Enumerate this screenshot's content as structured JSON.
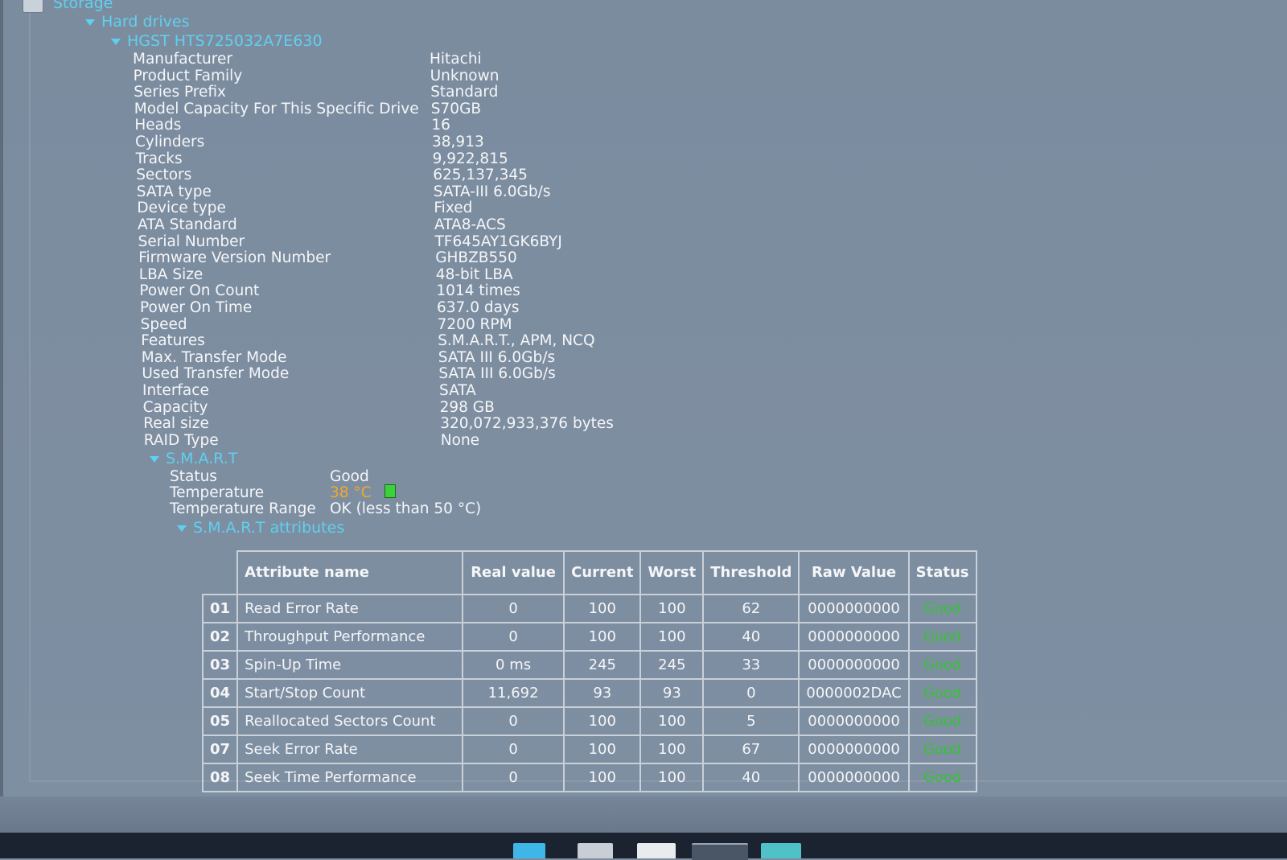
{
  "tree": {
    "storage_label": "Storage",
    "hard_drives_label": "Hard drives",
    "drive_label": "HGST HTS725032A7E630",
    "smart_label": "S.M.A.R.T",
    "smart_attributes_label": "S.M.A.R.T attributes"
  },
  "drive_properties": [
    {
      "label": "Manufacturer",
      "value": "Hitachi"
    },
    {
      "label": "Product Family",
      "value": "Unknown"
    },
    {
      "label": "Series Prefix",
      "value": "Standard"
    },
    {
      "label": "Model Capacity For This Specific Drive",
      "value": "S70GB"
    },
    {
      "label": "Heads",
      "value": "16"
    },
    {
      "label": "Cylinders",
      "value": "38,913"
    },
    {
      "label": "Tracks",
      "value": "9,922,815"
    },
    {
      "label": "Sectors",
      "value": "625,137,345"
    },
    {
      "label": "SATA type",
      "value": "SATA-III 6.0Gb/s"
    },
    {
      "label": "Device type",
      "value": "Fixed"
    },
    {
      "label": "ATA Standard",
      "value": "ATA8-ACS"
    },
    {
      "label": "Serial Number",
      "value": "TF645AY1GK6BYJ"
    },
    {
      "label": "Firmware Version Number",
      "value": "GHBZB550"
    },
    {
      "label": "LBA Size",
      "value": "48-bit LBA"
    },
    {
      "label": "Power On Count",
      "value": "1014 times"
    },
    {
      "label": "Power On Time",
      "value": "637.0 days"
    },
    {
      "label": "Speed",
      "value": "7200 RPM"
    },
    {
      "label": "Features",
      "value": "S.M.A.R.T., APM, NCQ"
    },
    {
      "label": "Max. Transfer Mode",
      "value": "SATA III 6.0Gb/s"
    },
    {
      "label": "Used Transfer Mode",
      "value": "SATA III 6.0Gb/s"
    },
    {
      "label": "Interface",
      "value": "SATA"
    },
    {
      "label": "Capacity",
      "value": "298 GB"
    },
    {
      "label": "Real size",
      "value": "320,072,933,376 bytes"
    },
    {
      "label": "RAID Type",
      "value": "None"
    }
  ],
  "smart": {
    "status_label": "Status",
    "status_value": "Good",
    "temperature_label": "Temperature",
    "temperature_value": "38 °C",
    "temperature_range_label": "Temperature Range",
    "temperature_range_value": "OK (less than 50 °C)"
  },
  "smart_table": {
    "headers": {
      "name": "Attribute name",
      "real_value": "Real value",
      "current": "Current",
      "worst": "Worst",
      "threshold": "Threshold",
      "raw_value": "Raw Value",
      "status": "Status"
    },
    "rows": [
      {
        "id": "01",
        "name": "Read Error Rate",
        "real": "0",
        "current": "100",
        "worst": "100",
        "threshold": "62",
        "raw": "0000000000",
        "status": "Good"
      },
      {
        "id": "02",
        "name": "Throughput Performance",
        "real": "0",
        "current": "100",
        "worst": "100",
        "threshold": "40",
        "raw": "0000000000",
        "status": "Good"
      },
      {
        "id": "03",
        "name": "Spin-Up Time",
        "real": "0 ms",
        "current": "245",
        "worst": "245",
        "threshold": "33",
        "raw": "0000000000",
        "status": "Good"
      },
      {
        "id": "04",
        "name": "Start/Stop Count",
        "real": "11,692",
        "current": "93",
        "worst": "93",
        "threshold": "0",
        "raw": "0000002DAC",
        "status": "Good"
      },
      {
        "id": "05",
        "name": "Reallocated Sectors Count",
        "real": "0",
        "current": "100",
        "worst": "100",
        "threshold": "5",
        "raw": "0000000000",
        "status": "Good"
      },
      {
        "id": "07",
        "name": "Seek Error Rate",
        "real": "0",
        "current": "100",
        "worst": "100",
        "threshold": "67",
        "raw": "0000000000",
        "status": "Good"
      },
      {
        "id": "08",
        "name": "Seek Time Performance",
        "real": "0",
        "current": "100",
        "worst": "100",
        "threshold": "40",
        "raw": "0000000000",
        "status": "Good"
      }
    ]
  },
  "colors": {
    "background": "#7c8c9f",
    "tree_link": "#5fd0f0",
    "good_status": "#35c235",
    "temperature": "#f0a830",
    "taskbar": "#1c2330"
  },
  "taskbar_icons": [
    "windows-start-icon",
    "file-explorer-icon",
    "store-icon",
    "app-window-icon",
    "photos-icon"
  ]
}
